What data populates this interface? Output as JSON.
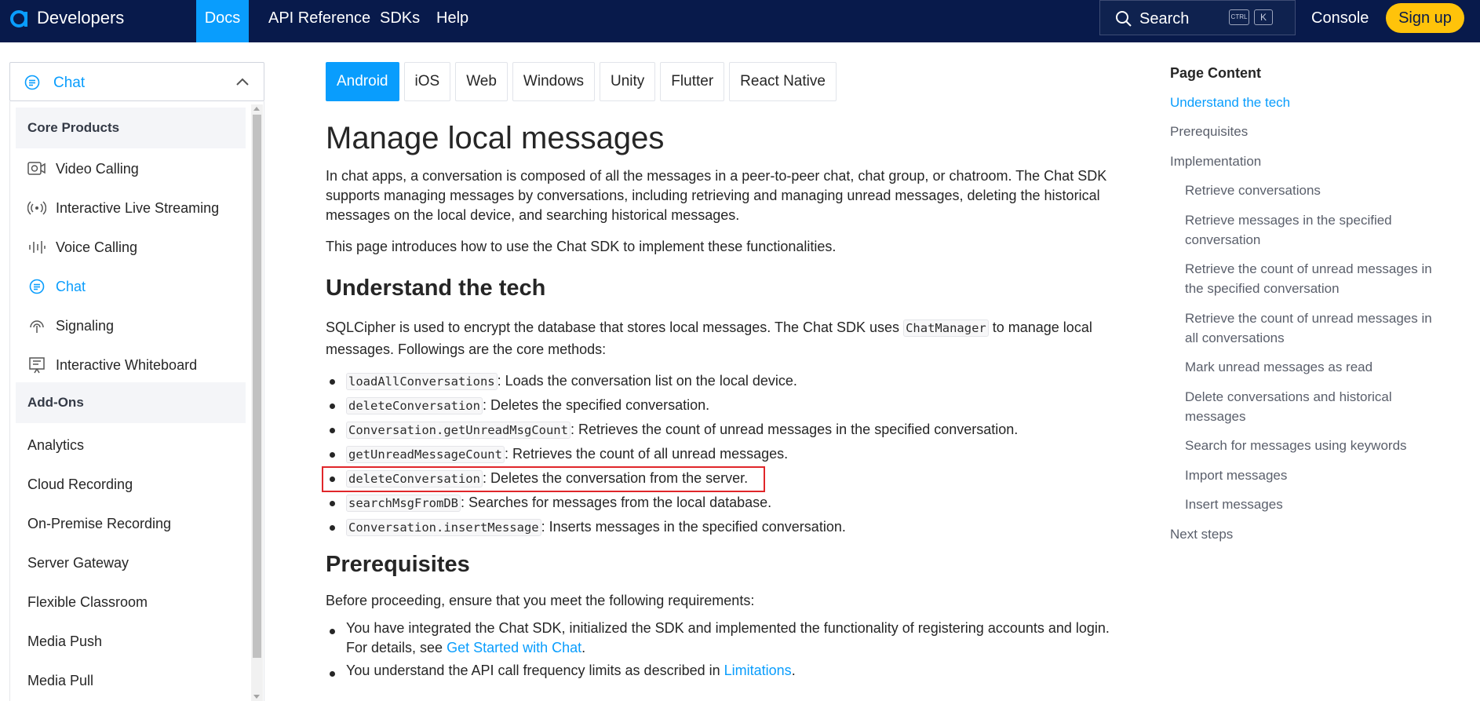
{
  "topnav": {
    "brand": "Developers",
    "links": [
      "Docs",
      "API Reference",
      "SDKs",
      "Help"
    ],
    "search_label": "Search",
    "search_kbd_ctrl": "CTRL",
    "search_kbd_k": "K",
    "console": "Console",
    "signup": "Sign up"
  },
  "colors": {
    "nav_bg": "#081a4b",
    "accent": "#099dfd",
    "signup": "#ffc30a",
    "highlight": "#e0262a"
  },
  "sidebar": {
    "product": "Chat",
    "section_core": "Core Products",
    "core_items": [
      {
        "label": "Video Calling",
        "icon": "video-icon"
      },
      {
        "label": "Interactive Live Streaming",
        "icon": "broadcast-icon"
      },
      {
        "label": "Voice Calling",
        "icon": "audio-wave-icon"
      },
      {
        "label": "Chat",
        "icon": "chat-icon"
      },
      {
        "label": "Signaling",
        "icon": "signal-icon"
      },
      {
        "label": "Interactive Whiteboard",
        "icon": "whiteboard-icon"
      }
    ],
    "section_addons": "Add-Ons",
    "addon_items": [
      "Analytics",
      "Cloud Recording",
      "On-Premise Recording",
      "Server Gateway",
      "Flexible Classroom",
      "Media Push",
      "Media Pull"
    ]
  },
  "platform_tabs": [
    "Android",
    "iOS",
    "Web",
    "Windows",
    "Unity",
    "Flutter",
    "React Native"
  ],
  "main": {
    "title": "Manage local messages",
    "intro": "In chat apps, a conversation is composed of all the messages in a peer-to-peer chat, chat group, or chatroom. The Chat SDK supports managing messages by conversations, including retrieving and managing unread messages, deleting the historical messages on the local device, and searching historical messages.",
    "intro2": "This page introduces how to use the Chat SDK to implement these functionalities.",
    "h_understand": "Understand the tech",
    "understand_p1": "SQLCipher is used to encrypt the database that stores local messages. The Chat SDK uses",
    "understand_code": "ChatManager",
    "understand_p2": "to manage local messages. Followings are the core methods:",
    "methods": [
      {
        "code": "loadAllConversations",
        "text": ": Loads the conversation list on the local device."
      },
      {
        "code": "deleteConversation",
        "text": ": Deletes the specified conversation."
      },
      {
        "code": "Conversation.getUnreadMsgCount",
        "text": ": Retrieves the count of unread messages in the specified conversation."
      },
      {
        "code": "getUnreadMessageCount",
        "text": ": Retrieves the count of all unread messages."
      },
      {
        "code": "deleteConversation",
        "text": ": Deletes the conversation from the server."
      },
      {
        "code": "searchMsgFromDB",
        "text": ": Searches for messages from the local database."
      },
      {
        "code": "Conversation.insertMessage",
        "text": ": Inserts messages in the specified conversation."
      }
    ],
    "h_prereq": "Prerequisites",
    "prereq_intro": "Before proceeding, ensure that you meet the following requirements:",
    "prereq1_a": "You have integrated the Chat SDK, initialized the SDK and implemented the functionality of registering accounts and login.",
    "prereq1_b": "For details, see",
    "prereq1_link": "Get Started with Chat",
    "prereq1_end": ".",
    "prereq2_a": "You understand the API call frequency limits as described in",
    "prereq2_link": "Limitations",
    "prereq2_end": "."
  },
  "toc": {
    "title": "Page Content",
    "items": [
      "Understand the tech",
      "Prerequisites",
      "Implementation",
      "Retrieve conversations",
      "Retrieve messages in the specified conversation",
      "Retrieve the count of unread messages in the specified conversation",
      "Retrieve the count of unread messages in all conversations",
      "Mark unread messages as read",
      "Delete conversations and historical messages",
      "Search for messages using keywords",
      "Import messages",
      "Insert messages",
      "Next steps"
    ]
  }
}
